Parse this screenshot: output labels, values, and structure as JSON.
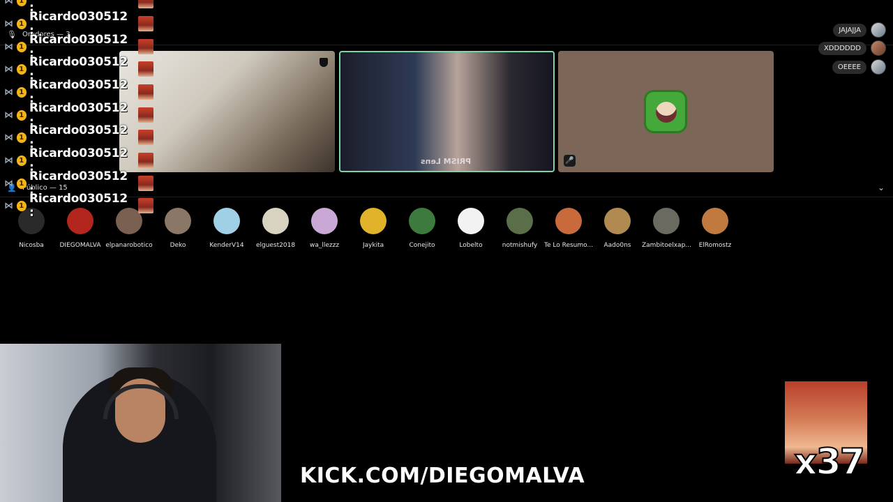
{
  "speakers_section": {
    "label": "Oradores — 3"
  },
  "public_section": {
    "label": "Público — 15"
  },
  "chat_overlay": {
    "username": "Ricardo030512 :",
    "rows": 10
  },
  "tiles": [
    {
      "name": "speaker-1",
      "state": "video"
    },
    {
      "name": "speaker-2",
      "state": "video-speaking",
      "lens_text": "PRISM Lens"
    },
    {
      "name": "speaker-3",
      "state": "avatar-muted"
    }
  ],
  "reactions": [
    {
      "text": "JAJAJJA"
    },
    {
      "text": "XDDDDDD"
    },
    {
      "text": "OEEEE"
    }
  ],
  "audience": [
    {
      "name": "Nicosba",
      "color": "#2a2a2a"
    },
    {
      "name": "DIEGOMALVA",
      "color": "#b3261e"
    },
    {
      "name": "elpanarobotico",
      "color": "#7a6050"
    },
    {
      "name": "Deko",
      "color": "#8a7766"
    },
    {
      "name": "KenderV14",
      "color": "#9fd0e6"
    },
    {
      "name": "elguest2018",
      "color": "#d8d2c0"
    },
    {
      "name": "wa_llezzz",
      "color": "#c9a8d6"
    },
    {
      "name": "Jaykita",
      "color": "#e0b32a"
    },
    {
      "name": "Conejito",
      "color": "#3d7a3d"
    },
    {
      "name": "Lobelto",
      "color": "#f2f2f2"
    },
    {
      "name": "notmishufy",
      "color": "#5a6e4a"
    },
    {
      "name": "Te Lo Resumo...",
      "color": "#c86a3c"
    },
    {
      "name": "Aado0ns",
      "color": "#b08a50"
    },
    {
      "name": "Zambitoelxap...",
      "color": "#6a6a60"
    },
    {
      "name": "ElRomostz",
      "color": "#c07a40"
    }
  ],
  "footer": {
    "channel": "KICK.COM/DIEGOMALVA",
    "multiplier": "x37"
  }
}
